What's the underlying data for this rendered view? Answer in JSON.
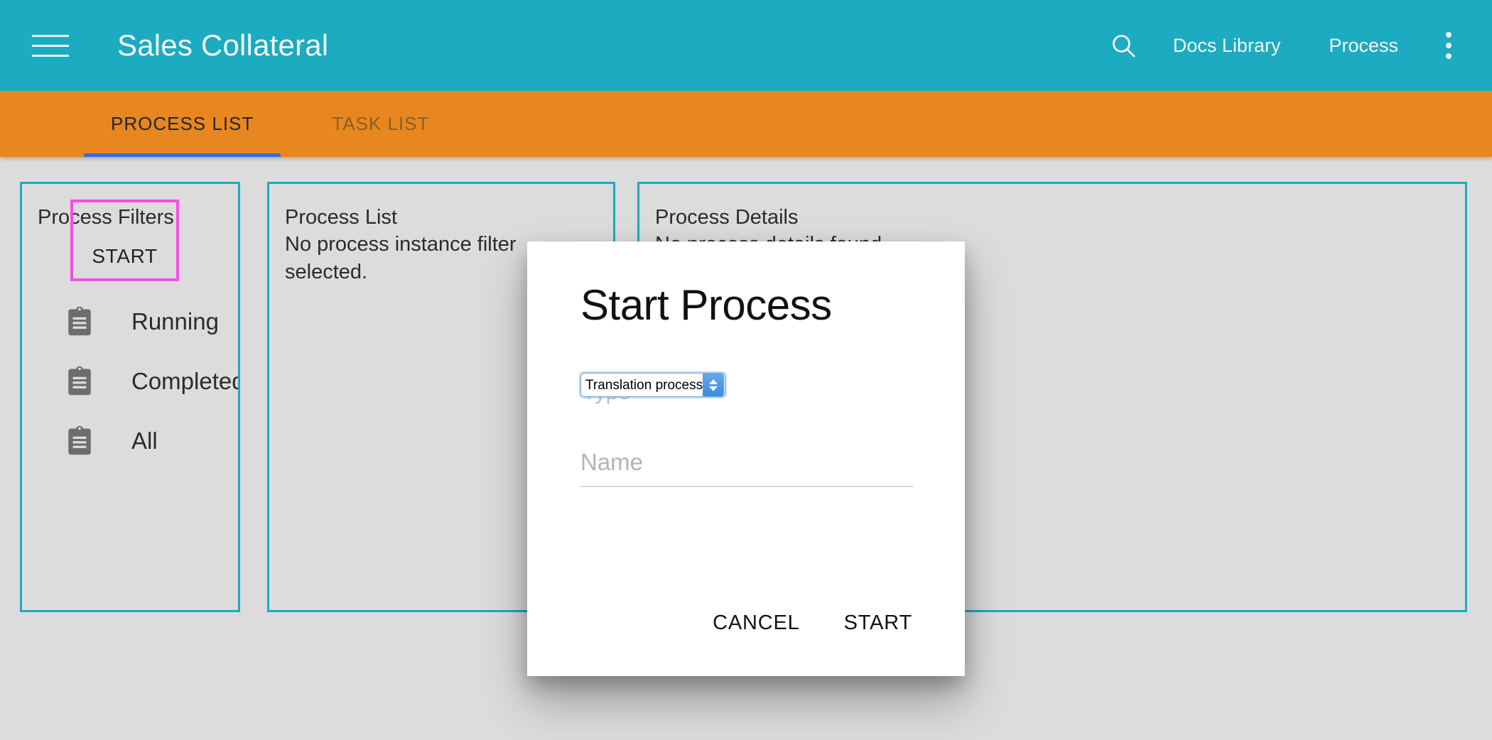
{
  "appbar": {
    "menu_icon": "hamburger-menu-icon",
    "title": "Sales Collateral",
    "search_icon": "search-icon",
    "links": [
      {
        "label": "Docs Library"
      },
      {
        "label": "Process"
      }
    ],
    "overflow_icon": "more-vertical-icon"
  },
  "tabs": [
    {
      "label": "PROCESS LIST",
      "active": true
    },
    {
      "label": "TASK LIST",
      "active": false
    }
  ],
  "panels": {
    "filters": {
      "heading": "Process Filters",
      "start_button": "START",
      "items": [
        {
          "icon": "clipboard-icon",
          "label": "Running"
        },
        {
          "icon": "clipboard-icon",
          "label": "Completed"
        },
        {
          "icon": "clipboard-icon",
          "label": "All"
        }
      ]
    },
    "process_list": {
      "heading": "Process List",
      "empty_text": "No process instance filter selected."
    },
    "process_details": {
      "heading": "Process Details",
      "empty_text": "No process details found."
    }
  },
  "dialog": {
    "title": "Start Process",
    "type_field": {
      "label": "Type",
      "value": "Translation process",
      "options": [
        "Translation process"
      ]
    },
    "name_field": {
      "placeholder": "Name",
      "value": ""
    },
    "cancel_label": "CANCEL",
    "start_label": "START"
  },
  "colors": {
    "appbar_teal": "#1CABC0",
    "tabbar_orange": "#E8871F",
    "tab_underline_blue": "#3F69D8",
    "panel_border_teal": "#1CABC0",
    "page_background": "#DCDCDC",
    "highlight_magenta": "#F54FE3",
    "select_focus_blue": "#3B8CE0"
  }
}
